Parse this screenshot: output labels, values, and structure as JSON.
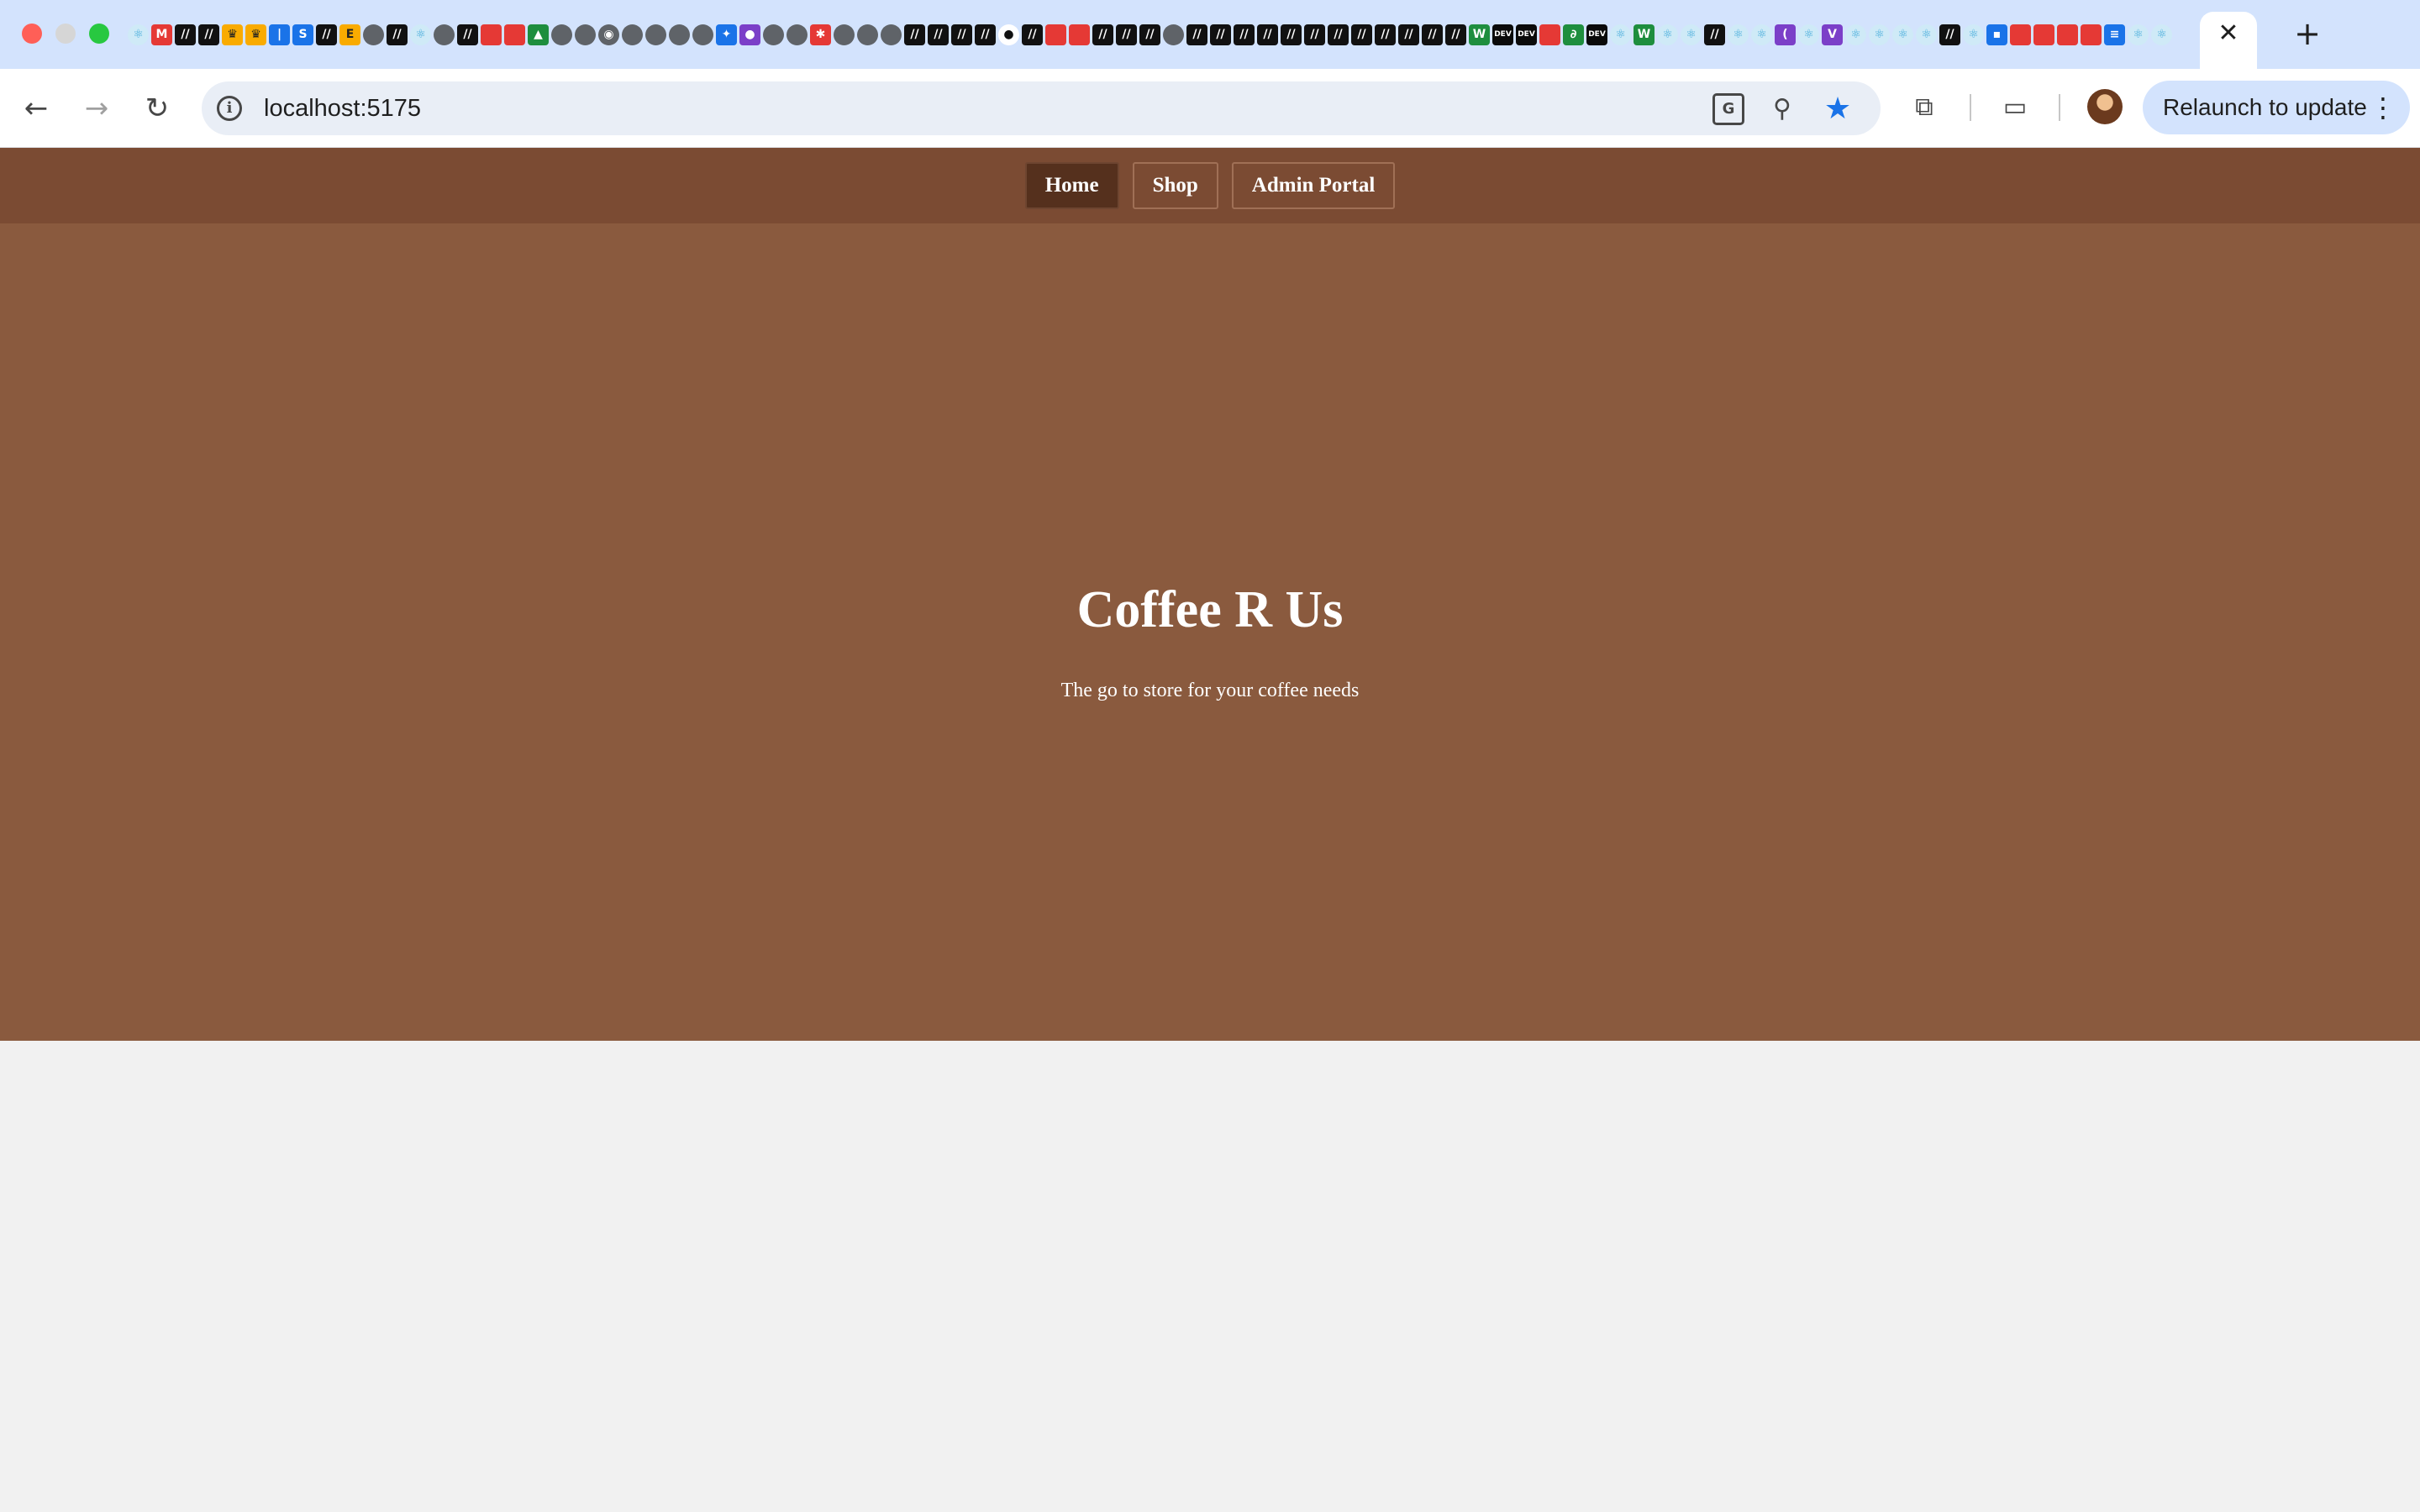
{
  "browser": {
    "active_tab_close": "✕",
    "new_tab": "+",
    "nav": {
      "back": "←",
      "forward": "→",
      "reload": "↻"
    },
    "address": {
      "url": "localhost:5175"
    },
    "relaunch_label": "Relaunch to update",
    "favicon_strip": [
      "react",
      "gmail",
      "m",
      "m",
      "lion",
      "lion",
      "dash",
      "sis",
      "m",
      "ejs",
      "globe",
      "m",
      "react",
      "globe",
      "m",
      "red",
      "red",
      "drive",
      "globe",
      "globe",
      "chrome",
      "globe",
      "globe",
      "globe",
      "globe",
      "gemini",
      "purple",
      "globe",
      "globe",
      "asterisk",
      "globe",
      "globe",
      "globe",
      "m",
      "m",
      "m",
      "m",
      "github",
      "m",
      "red",
      "red",
      "m",
      "m",
      "m",
      "globe",
      "m",
      "m",
      "m",
      "m",
      "m",
      "m",
      "m",
      "m",
      "m",
      "m",
      "m",
      "m",
      "w",
      "dev",
      "dev",
      "red",
      "ce",
      "dev",
      "react",
      "w",
      "react",
      "react",
      "m",
      "react",
      "react",
      "sword",
      "react",
      "vite",
      "react",
      "react",
      "react",
      "react",
      "m",
      "react",
      "chat",
      "red",
      "red",
      "red",
      "red",
      "docs",
      "react",
      "react"
    ]
  },
  "site": {
    "nav": [
      {
        "label": "Home",
        "active": true
      },
      {
        "label": "Shop",
        "active": false
      },
      {
        "label": "Admin Portal",
        "active": false
      }
    ],
    "hero": {
      "title": "Coffee R Us",
      "subtitle": "The go to store for your coffee needs"
    }
  },
  "colors": {
    "nav_bar": "#7b4b33",
    "hero_bg": "#8a5a3e",
    "active_link": "#55301d",
    "page_bg": "#f1f1f1",
    "chrome_tabstrip": "#d3e3fd"
  }
}
